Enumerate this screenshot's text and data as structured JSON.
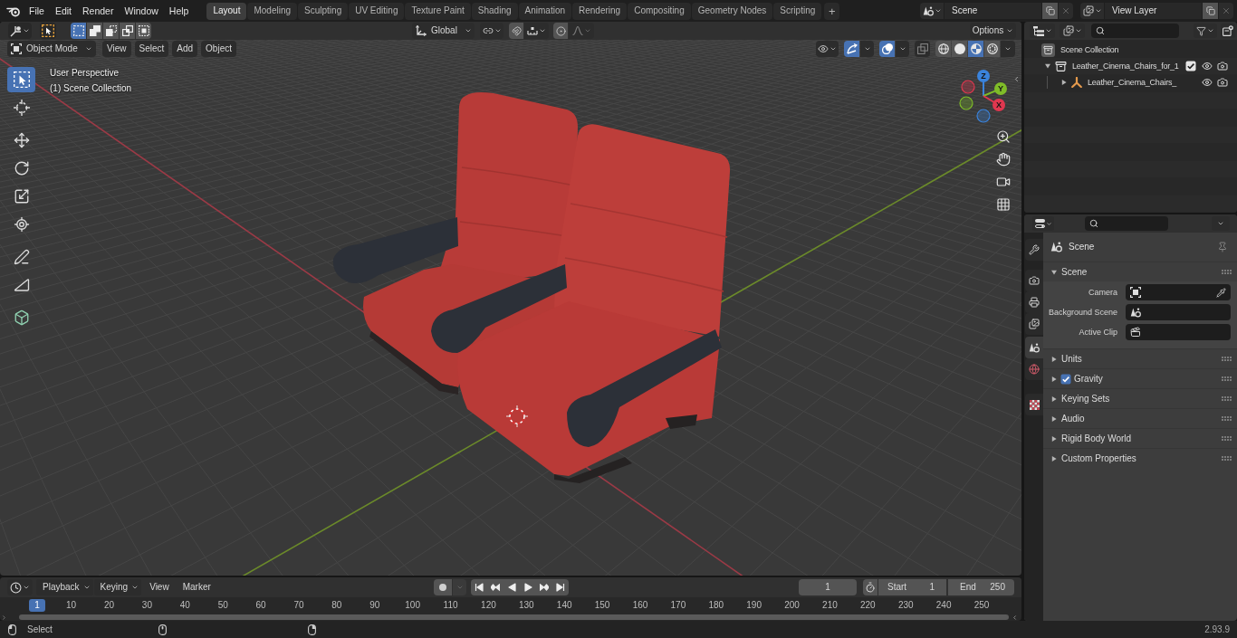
{
  "top_bar": {
    "menus": [
      "File",
      "Edit",
      "Render",
      "Window",
      "Help"
    ],
    "workspaces": [
      {
        "label": "Layout",
        "selected": true
      },
      {
        "label": "Modeling",
        "selected": false
      },
      {
        "label": "Sculpting",
        "selected": false
      },
      {
        "label": "UV Editing",
        "selected": false
      },
      {
        "label": "Texture Paint",
        "selected": false
      },
      {
        "label": "Shading",
        "selected": false
      },
      {
        "label": "Animation",
        "selected": false
      },
      {
        "label": "Rendering",
        "selected": false
      },
      {
        "label": "Compositing",
        "selected": false
      },
      {
        "label": "Geometry Nodes",
        "selected": false
      },
      {
        "label": "Scripting",
        "selected": false
      }
    ],
    "add_workspace": "+",
    "scene": "Scene",
    "view_layer": "View Layer"
  },
  "viewport": {
    "tool_header": {
      "select_modes": [
        {
          "kind": "set",
          "selected": true
        },
        {
          "kind": "extend",
          "selected": false
        },
        {
          "kind": "subtract",
          "selected": false
        },
        {
          "kind": "difference",
          "selected": false
        },
        {
          "kind": "intersect",
          "selected": false
        }
      ],
      "orientation": "Global",
      "options": "Options"
    },
    "header": {
      "mode": "Object Mode",
      "menus": [
        "View",
        "Select",
        "Add",
        "Object"
      ],
      "gizmos_on": true,
      "overlays_on": true,
      "xray_on": false,
      "shading": [
        {
          "kind": "wireframe",
          "selected": false
        },
        {
          "kind": "solid",
          "selected": false
        },
        {
          "kind": "material",
          "selected": true
        },
        {
          "kind": "rendered",
          "selected": false
        }
      ]
    },
    "tool_groups": [
      {
        "tools": [
          {
            "kind": "select_box",
            "selected": true
          },
          {
            "kind": "cursor",
            "selected": false
          }
        ]
      },
      {
        "tools": [
          {
            "kind": "move",
            "selected": false
          },
          {
            "kind": "rotate",
            "selected": false
          },
          {
            "kind": "scale",
            "selected": false
          },
          {
            "kind": "transform",
            "selected": false
          }
        ]
      },
      {
        "tools": [
          {
            "kind": "annotate",
            "selected": false
          },
          {
            "kind": "measure",
            "selected": false
          }
        ]
      },
      {
        "tools": [
          {
            "kind": "add_cube",
            "selected": false
          }
        ]
      }
    ],
    "view_info": [
      "User Perspective",
      "(1) Scene Collection"
    ],
    "gizmo_axes": [
      {
        "kind": "z",
        "label": "Z",
        "color": "#3a83dc"
      },
      {
        "kind": "y",
        "label": "Y",
        "color": "#7fbc28"
      },
      {
        "kind": "x",
        "label": "X",
        "color": "#e0374f"
      }
    ]
  },
  "timeline": {
    "menus": [
      {
        "kind": "dropdown",
        "label": "Playback"
      },
      {
        "kind": "dropdown",
        "label": "Keying"
      },
      {
        "kind": "menu",
        "label": "View"
      },
      {
        "kind": "menu",
        "label": "Marker"
      }
    ],
    "auto_keying": false,
    "current_frame": "1",
    "start": {
      "label": "Start",
      "value": "1"
    },
    "end": {
      "label": "End",
      "value": "250"
    },
    "playhead": "1",
    "ruler": [
      "10",
      "20",
      "30",
      "40",
      "50",
      "60",
      "70",
      "80",
      "90",
      "100",
      "110",
      "120",
      "130",
      "140",
      "150",
      "160",
      "170",
      "180",
      "190",
      "200",
      "210",
      "220",
      "230",
      "240",
      "250"
    ]
  },
  "outliner": {
    "items": [
      {
        "kind": "scene_collection",
        "label": "Scene Collection",
        "children": [
          {
            "kind": "collection",
            "label": "Leather_Cinema_Chairs_for_1",
            "expanded": true,
            "checked": true,
            "visible": true,
            "children": [
              {
                "kind": "empty",
                "label": "Leather_Cinema_Chairs_",
                "expanded": false,
                "visible": true
              }
            ]
          }
        ]
      }
    ]
  },
  "properties": {
    "tab_groups": [
      {
        "tabs": [
          {
            "kind": "tool",
            "selected": false
          }
        ]
      },
      {
        "tabs": [
          {
            "kind": "render",
            "selected": false
          },
          {
            "kind": "output",
            "selected": false
          },
          {
            "kind": "view_layer",
            "selected": false
          }
        ]
      },
      {
        "tabs": [
          {
            "kind": "scene",
            "selected": true
          },
          {
            "kind": "world",
            "selected": false
          }
        ]
      },
      {
        "tabs": [
          {
            "kind": "texture",
            "selected": false
          }
        ]
      }
    ],
    "context": "Scene",
    "panels": [
      {
        "kind": "plain",
        "title": "Scene",
        "expanded": true,
        "fields": [
          {
            "kind": "camera",
            "label": "Camera"
          },
          {
            "kind": "scene",
            "label": "Background Scene"
          },
          {
            "kind": "clip",
            "label": "Active Clip"
          }
        ]
      },
      {
        "kind": "plain",
        "title": "Units",
        "expanded": false
      },
      {
        "kind": "toggle",
        "title": "Gravity",
        "expanded": false,
        "checked": true
      },
      {
        "kind": "plain",
        "title": "Keying Sets",
        "expanded": false
      },
      {
        "kind": "plain",
        "title": "Audio",
        "expanded": false
      },
      {
        "kind": "plain",
        "title": "Rigid Body World",
        "expanded": false
      },
      {
        "kind": "plain",
        "title": "Custom Properties",
        "expanded": false
      }
    ]
  },
  "status_bar": {
    "hint": "Select",
    "version": "2.93.9"
  }
}
